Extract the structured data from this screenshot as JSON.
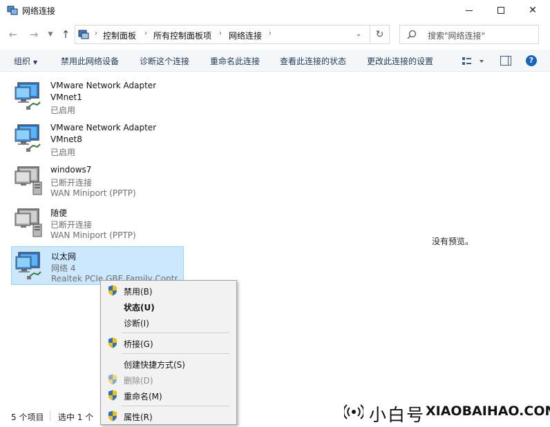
{
  "window": {
    "title": "网络连接",
    "controls": [
      "minimize",
      "maximize",
      "close"
    ]
  },
  "address": {
    "breadcrumbs": [
      "控制面板",
      "所有控制面板项",
      "网络连接"
    ],
    "search_placeholder": "搜索\"网络连接\""
  },
  "commands": {
    "organize": "组织",
    "disable": "禁用此网络设备",
    "diagnose": "诊断这个连接",
    "rename": "重命名此连接",
    "status": "查看此连接的状态",
    "settings": "更改此连接的设置"
  },
  "connections": [
    {
      "name": "VMware Network Adapter",
      "detail": "VMnet1",
      "status": "已启用",
      "icon": "lan-adapter-icon",
      "state": "enabled"
    },
    {
      "name": "VMware Network Adapter",
      "detail": "VMnet8",
      "status": "已启用",
      "icon": "lan-adapter-icon",
      "state": "enabled"
    },
    {
      "name": "windows7",
      "detail": "已断开连接",
      "status": "WAN Miniport (PPTP)",
      "icon": "dialup-connection-icon",
      "state": "disconnected"
    },
    {
      "name": "随便",
      "detail": "已断开连接",
      "status": "WAN Miniport (PPTP)",
      "icon": "dialup-connection-icon",
      "state": "disconnected"
    },
    {
      "name": "以太网",
      "detail": "网络 4",
      "status": "Realtek PCIe GBE Family Contr",
      "icon": "lan-adapter-icon",
      "state": "selected"
    }
  ],
  "preview": {
    "text": "没有预览。"
  },
  "context_menu": {
    "items": [
      {
        "label": "禁用(B)",
        "shield": true
      },
      {
        "label": "状态(U)",
        "bold": true
      },
      {
        "label": "诊断(I)"
      },
      {
        "label": "桥接(G)",
        "shield": true
      },
      {
        "label": "创建快捷方式(S)"
      },
      {
        "label": "删除(D)",
        "shield": true,
        "disabled": true
      },
      {
        "label": "重命名(M)",
        "shield": true
      },
      {
        "label": "属性(R)",
        "shield": true
      }
    ]
  },
  "status": {
    "count": "5 个项目",
    "selection": "选中 1 个"
  },
  "watermark": {
    "brand_cn": "小白号",
    "brand_en": "XIAOBAIHAO.COM"
  },
  "colors": {
    "selection_bg": "#cce8ff",
    "selection_border": "#99d1ff",
    "command_text": "#1e395b",
    "help_blue": "#1565c0",
    "shield_blue": "#2a6fc9",
    "shield_yellow": "#f2c200"
  }
}
